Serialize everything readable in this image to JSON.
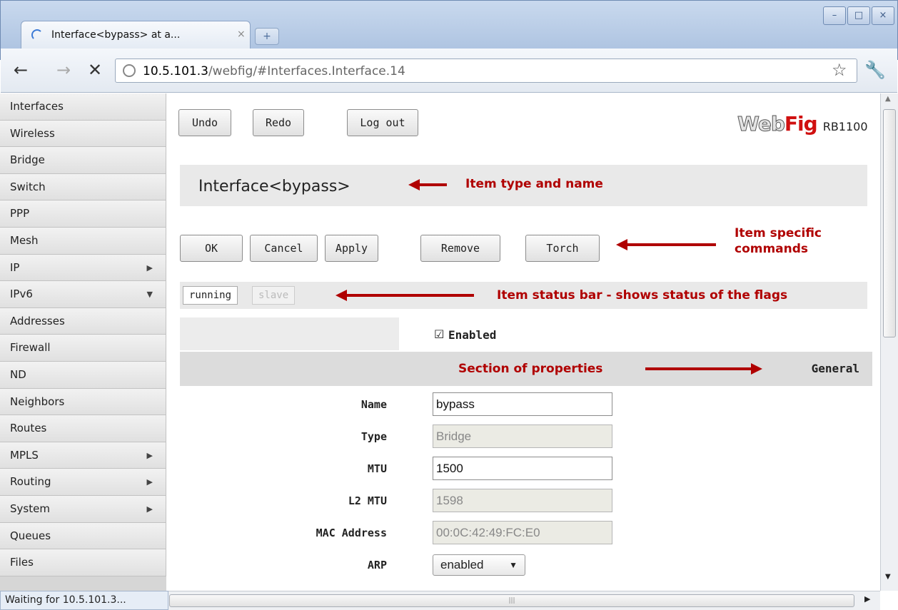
{
  "browser": {
    "tab_title": "Interface<bypass> at a...",
    "tab_close": "×",
    "new_tab": "+",
    "window_buttons": [
      "–",
      "□",
      "×"
    ],
    "url_host": "10.5.101.3",
    "url_path": "/webfig/#Interfaces.Interface.14",
    "status": "Waiting for 10.5.101.3..."
  },
  "sidebar": {
    "items": [
      {
        "label": "Interfaces",
        "arrow": ""
      },
      {
        "label": "Wireless",
        "arrow": ""
      },
      {
        "label": "Bridge",
        "arrow": ""
      },
      {
        "label": "Switch",
        "arrow": ""
      },
      {
        "label": "PPP",
        "arrow": ""
      },
      {
        "label": "Mesh",
        "arrow": ""
      },
      {
        "label": "IP",
        "arrow": "▶"
      },
      {
        "label": "IPv6",
        "arrow": "▼"
      },
      {
        "label": "Addresses",
        "arrow": ""
      },
      {
        "label": "Firewall",
        "arrow": ""
      },
      {
        "label": "ND",
        "arrow": ""
      },
      {
        "label": "Neighbors",
        "arrow": ""
      },
      {
        "label": "Routes",
        "arrow": ""
      },
      {
        "label": "MPLS",
        "arrow": "▶"
      },
      {
        "label": "Routing",
        "arrow": "▶"
      },
      {
        "label": "System",
        "arrow": "▶"
      },
      {
        "label": "Queues",
        "arrow": ""
      },
      {
        "label": "Files",
        "arrow": ""
      }
    ]
  },
  "toolbar": {
    "undo": "Undo",
    "redo": "Redo",
    "logout": "Log out"
  },
  "logo": {
    "web": "Web",
    "fig": "Fig",
    "model": "RB1100"
  },
  "item": {
    "title": "Interface<bypass>"
  },
  "commands": {
    "ok": "OK",
    "cancel": "Cancel",
    "apply": "Apply",
    "remove": "Remove",
    "torch": "Torch"
  },
  "flags": {
    "running": "running",
    "slave": "slave"
  },
  "annotations": {
    "type_name": "Item type and name",
    "commands_line1": "Item specific",
    "commands_line2": "commands",
    "status_bar": "Item status bar - shows status of the flags",
    "section": "Section of properties"
  },
  "properties": {
    "enabled_label": "Enabled",
    "enabled_checked": true,
    "section_name": "General",
    "rows": [
      {
        "label": "Name",
        "value": "bypass",
        "readonly": false
      },
      {
        "label": "Type",
        "value": "Bridge",
        "readonly": true
      },
      {
        "label": "MTU",
        "value": "1500",
        "readonly": false
      },
      {
        "label": "L2 MTU",
        "value": "1598",
        "readonly": true
      },
      {
        "label": "MAC Address",
        "value": "00:0C:42:49:FC:E0",
        "readonly": true
      },
      {
        "label": "ARP",
        "value": "enabled",
        "select": true
      }
    ]
  }
}
